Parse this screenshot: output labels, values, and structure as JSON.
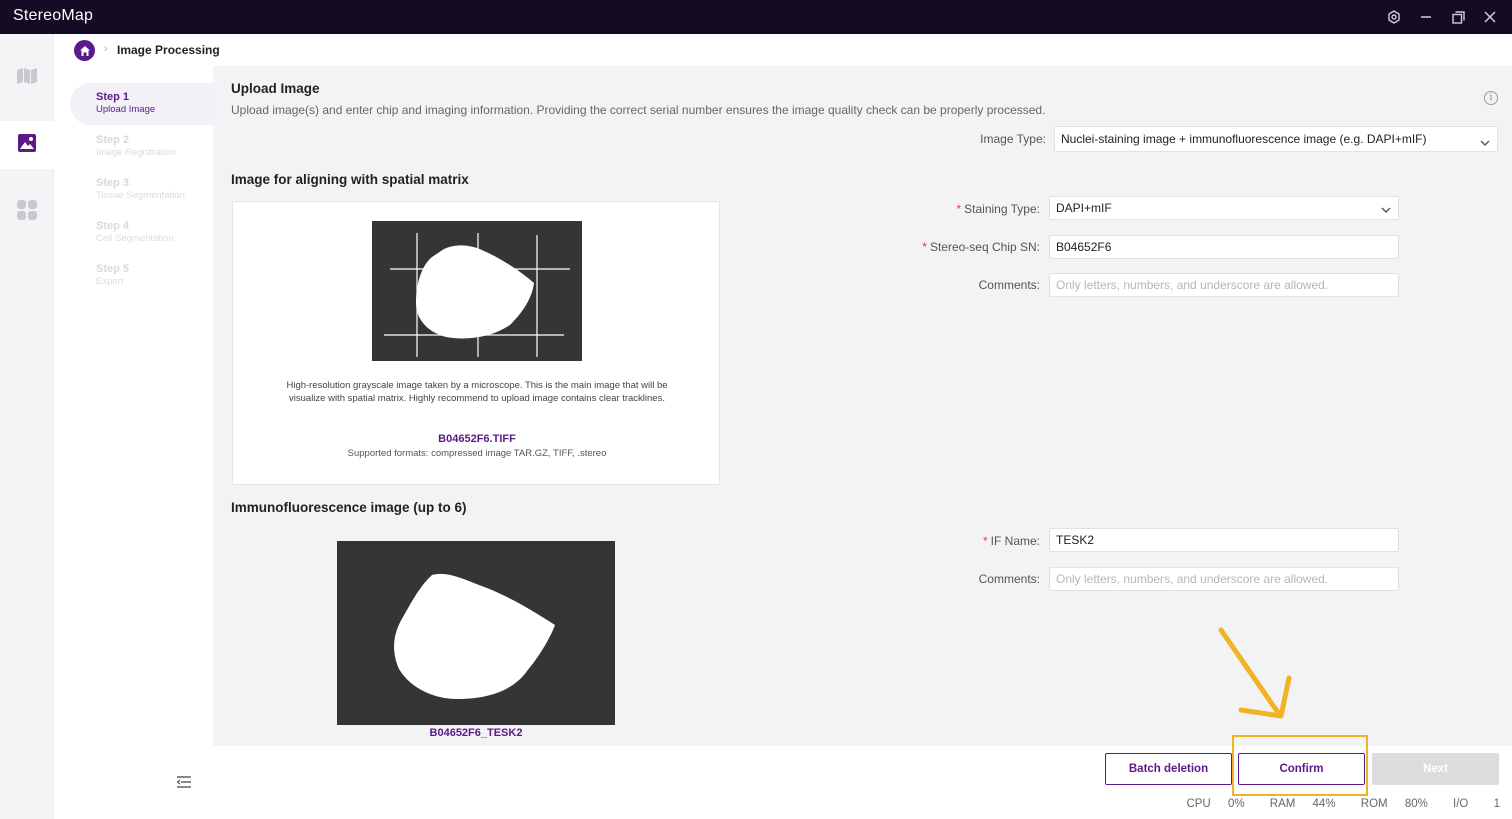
{
  "app": {
    "title": "StereoMap"
  },
  "breadcrumb": {
    "current": "Image Processing"
  },
  "steps": [
    {
      "title": "Step 1",
      "subtitle": "Upload Image",
      "active": true
    },
    {
      "title": "Step 2",
      "subtitle": "Image Registration",
      "active": false
    },
    {
      "title": "Step 3",
      "subtitle": "Tissue Segmentation",
      "active": false
    },
    {
      "title": "Step 4",
      "subtitle": "Cell Segmentation",
      "active": false
    },
    {
      "title": "Step 5",
      "subtitle": "Export",
      "active": false
    }
  ],
  "upload": {
    "title": "Upload Image",
    "description": "Upload image(s) and enter chip and imaging information. Providing the correct serial number ensures the image quality check can be properly processed.",
    "image_type_label": "Image Type:",
    "image_type_value": "Nuclei-staining image + immunofluorescence image (e.g. DAPI+mIF)"
  },
  "align": {
    "title": "Image for aligning with spatial matrix",
    "card_description": "High-resolution grayscale image taken by a microscope. This is the main image that will be visualize with spatial matrix. Highly recommend to upload image contains clear tracklines.",
    "file_name": "B04652F6.TIFF",
    "formats": "Supported formats: compressed image TAR.GZ, TIFF, .stereo",
    "staining_label": "Staining Type:",
    "staining_value": "DAPI+mIF",
    "chip_label": "Stereo-seq Chip SN:",
    "chip_value": "B04652F6",
    "comments_label": "Comments:",
    "comments_placeholder": "Only letters, numbers, and underscore are allowed."
  },
  "immuno": {
    "title": "Immunofluorescence image (up to 6)",
    "file_name": "B04652F6_TESK2",
    "if_name_label": "IF Name:",
    "if_name_value": "TESK2",
    "comments_label": "Comments:",
    "comments_placeholder": "Only letters, numbers, and underscore are allowed."
  },
  "footer": {
    "batch_deletion": "Batch deletion",
    "confirm": "Confirm",
    "next": "Next"
  },
  "stats": {
    "cpu_label": "CPU",
    "cpu_value": "0%",
    "ram_label": "RAM",
    "ram_value": "44%",
    "rom_label": "ROM",
    "rom_value": "80%",
    "io_label": "I/O",
    "io_value": "1"
  },
  "colors": {
    "brand": "#5b1a8a",
    "titlebar": "#140c24",
    "highlight": "#f0b323"
  },
  "icons": [
    "settings-icon",
    "minimize-icon",
    "restore-icon",
    "close-icon",
    "map-icon",
    "image-icon",
    "apps-icon",
    "home-icon",
    "info-icon",
    "chevron-down-icon",
    "menu-icon",
    "arrow-annotation-icon"
  ]
}
